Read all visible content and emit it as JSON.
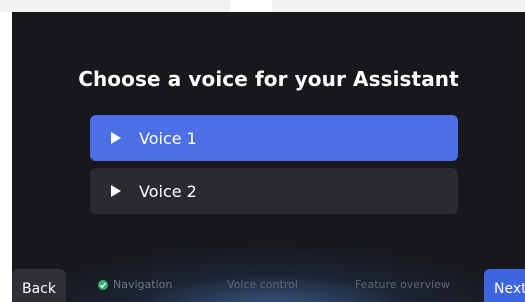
{
  "page": {
    "title": "Choose a voice for your Assistant"
  },
  "voices": [
    {
      "label": "Voice 1",
      "selected": true
    },
    {
      "label": "Voice 2",
      "selected": false
    }
  ],
  "footer": {
    "back_label": "Back",
    "next_label": "Next",
    "steps": [
      {
        "label": "Navigation",
        "status": "complete"
      },
      {
        "label": "Voice control",
        "status": "current"
      },
      {
        "label": "Feature overview",
        "status": "upcoming"
      }
    ]
  },
  "colors": {
    "screen_background": "#18181c",
    "selected_option": "#4c6fe6",
    "option": "#2a2a31",
    "next_button": "#3f64e0",
    "back_button": "#2f2f36",
    "step_complete": "#2eb56b"
  },
  "icons": [
    "play-icon",
    "check-circle-icon"
  ]
}
